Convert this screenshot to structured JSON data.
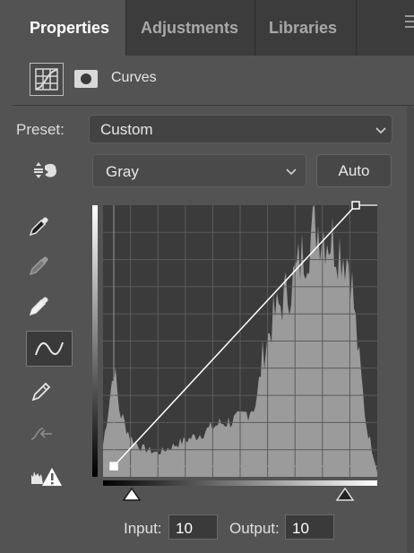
{
  "tabs": [
    {
      "label": "Properties",
      "active": true
    },
    {
      "label": "Adjustments",
      "active": false
    },
    {
      "label": "Libraries",
      "active": false
    }
  ],
  "header": {
    "title": "Curves",
    "icons": [
      "curves-adjustment-icon",
      "layer-mask-icon"
    ]
  },
  "preset": {
    "label": "Preset:",
    "value": "Custom"
  },
  "channel": {
    "value": "Gray"
  },
  "auto_button": {
    "label": "Auto"
  },
  "tools": [
    "on-image-adjust-icon",
    "black-point-eyedropper-icon",
    "gray-point-eyedropper-icon",
    "white-point-eyedropper-icon",
    "edit-points-curve-icon",
    "draw-curve-pencil-icon",
    "smooth-curve-icon",
    "clipping-warning-icon"
  ],
  "selected_tool": "edit-points-curve-icon",
  "curve": {
    "points": [
      {
        "input": 10,
        "output": 10
      },
      {
        "input": 235,
        "output": 255
      }
    ],
    "selected_point_index": 0
  },
  "input": {
    "label": "Input:",
    "value": "10"
  },
  "output": {
    "label": "Output:",
    "value": "10"
  },
  "sliders": {
    "black_point": 10,
    "white_point": 235
  },
  "colors": {
    "panel_bg": "#535353",
    "tab_bar_bg": "#3c3c3c",
    "graph_bg": "#3b3b3b",
    "histogram": "#9b9b9b",
    "curve_line": "#ffffff"
  }
}
